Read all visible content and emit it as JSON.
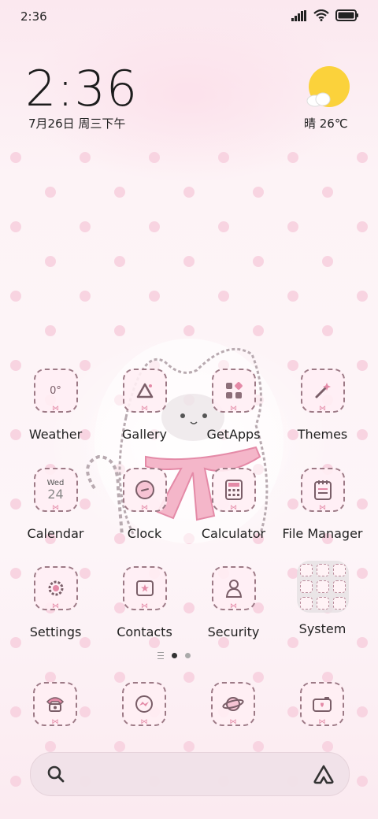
{
  "status_bar": {
    "time": "2:36",
    "icons": [
      "signal-icon",
      "wifi-icon",
      "battery-icon"
    ]
  },
  "clock_widget": {
    "time": "2:36",
    "date": "7月26日 周三下午"
  },
  "weather_widget": {
    "icon": "sun-cloud-icon",
    "text": "晴 26℃"
  },
  "home_apps": [
    {
      "label": "Weather",
      "icon": "weather-icon",
      "glyph": "0°"
    },
    {
      "label": "Gallery",
      "icon": "gallery-icon",
      "glyph": ""
    },
    {
      "label": "GetApps",
      "icon": "getapps-icon",
      "glyph": ""
    },
    {
      "label": "Themes",
      "icon": "themes-icon",
      "glyph": ""
    },
    {
      "label": "Calendar",
      "icon": "calendar-icon",
      "glyph_day": "Wed",
      "glyph_date": "24"
    },
    {
      "label": "Clock",
      "icon": "clock-icon",
      "glyph": ""
    },
    {
      "label": "Calculator",
      "icon": "calculator-icon",
      "glyph": ""
    },
    {
      "label": "File Manager",
      "icon": "file-manager-icon",
      "glyph": ""
    },
    {
      "label": "Settings",
      "icon": "settings-icon",
      "glyph": ""
    },
    {
      "label": "Contacts",
      "icon": "contacts-icon",
      "glyph": ""
    },
    {
      "label": "Security",
      "icon": "security-icon",
      "glyph": ""
    }
  ],
  "folder": {
    "label": "System",
    "icon": "folder-icon"
  },
  "page_indicator": {
    "pages": 2,
    "active": 1
  },
  "dock": [
    {
      "icon": "phone-icon"
    },
    {
      "icon": "messaging-icon"
    },
    {
      "icon": "browser-planet-icon"
    },
    {
      "icon": "camera-icon"
    }
  ],
  "search_bar": {
    "left_icon": "search-icon",
    "right_icon": "assistant-icon"
  },
  "colors": {
    "background": "#fbeef3",
    "polka_dot": "#f8d4e1",
    "icon_outline": "#9d7a86",
    "accent_pink": "#e48aa7",
    "sun": "#fbd23b"
  }
}
